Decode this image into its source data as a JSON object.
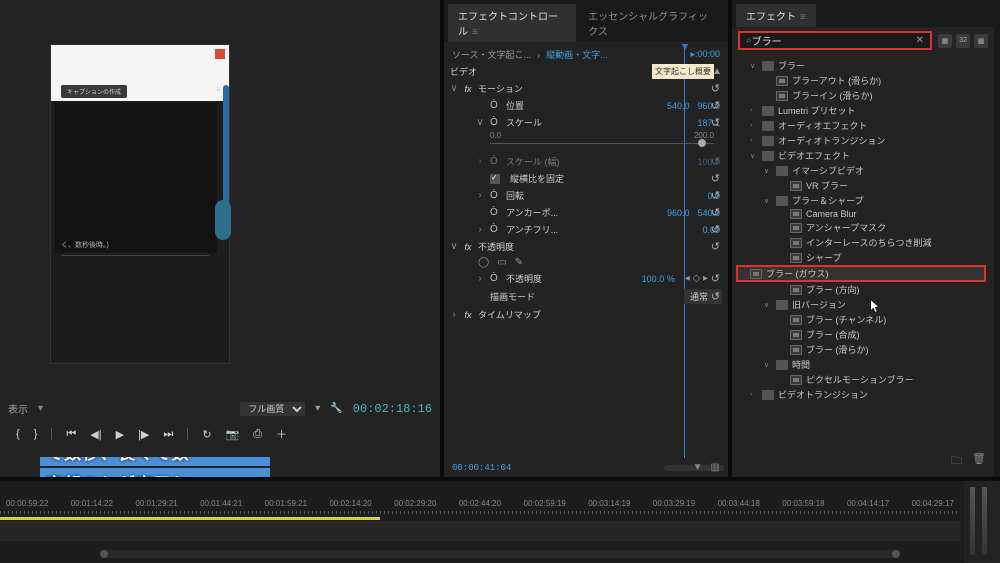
{
  "monitor": {
    "chip": "キャプションの作成",
    "preview_text": "く、数秒後時。)",
    "caption_line1": "て数秒、長くて数",
    "caption_line2": "字起こしが完了し",
    "display_label": "表示",
    "fit_label": "フル画質",
    "timecode": "00:02:18:16",
    "transport": {
      "first": "⏮",
      "step_back": "◀|",
      "back": "◀",
      "play": "▶",
      "fwd": "▶",
      "step_fwd": "|▶",
      "last": "⏭",
      "mark_in": "{",
      "mark_out": "}",
      "loop": "↻",
      "cam": "📷",
      "export": "⎙",
      "plus": "＋"
    }
  },
  "ec": {
    "tab_active": "エフェクトコントロール",
    "tab2": "エッセンシャルグラフィックス",
    "source_prefix": "ソース・文字起こ...",
    "src_link": "縦動画・文字...",
    "tl_start": ":00:00",
    "marker_label": "文字起こし概要",
    "video_label": "ビデオ",
    "motion": "モーション",
    "position": "位置",
    "pos_x": "540.0",
    "pos_y": "960.0",
    "scale": "スケール",
    "scale_val": "187.1",
    "slider_min": "0.0",
    "slider_max": "200.0",
    "scale_w": "スケール (幅)",
    "scale_w_val": "100.0",
    "uniform": "縦横比を固定",
    "rotation": "回転",
    "rotation_val": "0.0",
    "anchor": "アンカーポ...",
    "anchor_x": "960.0",
    "anchor_y": "540.0",
    "antiflicker": "アンチフリ...",
    "antiflicker_val": "0.00",
    "opacity": "不透明度",
    "opacity_val_lbl": "不透明度",
    "opacity_val": "100.0 %",
    "blend": "描画モード",
    "blend_val": "通常",
    "timeremap": "タイムリマップ",
    "foot_tc": "00:00:41:04"
  },
  "fx": {
    "tab": "エフェクト",
    "search": "ブラー",
    "icons": [
      "▦",
      "32",
      "▦"
    ],
    "tree": [
      {
        "ind": 1,
        "arr": "∨",
        "type": "fold",
        "txt": "ブラー"
      },
      {
        "ind": 2,
        "arr": "",
        "type": "pre",
        "txt": "ブラーアウト (滑らか)"
      },
      {
        "ind": 2,
        "arr": "",
        "type": "pre",
        "txt": "ブラーイン (滑らか)"
      },
      {
        "ind": 1,
        "arr": "›",
        "type": "fold",
        "txt": "Lumetri プリセット"
      },
      {
        "ind": 1,
        "arr": "›",
        "type": "fold",
        "txt": "オーディオエフェクト"
      },
      {
        "ind": 1,
        "arr": "›",
        "type": "fold",
        "txt": "オーディオトランジション"
      },
      {
        "ind": 1,
        "arr": "∨",
        "type": "fold",
        "txt": "ビデオエフェクト"
      },
      {
        "ind": 2,
        "arr": "∨",
        "type": "fold",
        "txt": "イマーシブビデオ"
      },
      {
        "ind": 3,
        "arr": "",
        "type": "pre",
        "txt": "VR ブラー"
      },
      {
        "ind": 2,
        "arr": "∨",
        "type": "fold",
        "txt": "ブラー＆シャープ"
      },
      {
        "ind": 3,
        "arr": "",
        "type": "pre",
        "txt": "Camera Blur"
      },
      {
        "ind": 3,
        "arr": "",
        "type": "pre",
        "txt": "アンシャープマスク"
      },
      {
        "ind": 3,
        "arr": "",
        "type": "pre",
        "txt": "インターレースのちらつき削減"
      },
      {
        "ind": 3,
        "arr": "",
        "type": "pre",
        "txt": "シャープ"
      },
      {
        "ind": 3,
        "arr": "",
        "type": "pre",
        "txt": "ブラー (ガウス)",
        "hl": true
      },
      {
        "ind": 3,
        "arr": "",
        "type": "pre",
        "txt": "ブラー (方向)"
      },
      {
        "ind": 2,
        "arr": "∨",
        "type": "fold",
        "txt": "旧バージョン"
      },
      {
        "ind": 3,
        "arr": "",
        "type": "pre",
        "txt": "ブラー (チャンネル)"
      },
      {
        "ind": 3,
        "arr": "",
        "type": "pre",
        "txt": "ブラー (合成)"
      },
      {
        "ind": 3,
        "arr": "",
        "type": "pre",
        "txt": "ブラー (滑らか)"
      },
      {
        "ind": 2,
        "arr": "∨",
        "type": "fold",
        "txt": "時間"
      },
      {
        "ind": 3,
        "arr": "",
        "type": "pre",
        "txt": "ピクセルモーションブラー"
      },
      {
        "ind": 1,
        "arr": "›",
        "type": "fold",
        "txt": "ビデオトランジション"
      }
    ]
  },
  "timeline": {
    "marks": [
      "00:00:59:22",
      "00:01:14:22",
      "00:01:29:21",
      "00:01:44:21",
      "00:01:59:21",
      "00:02:14:20",
      "00:02:29:20",
      "00:02:44:20",
      "00:02:59:19",
      "00:03:14:19",
      "00:03:29:19",
      "00:03:44:18",
      "00:03:59:18",
      "00:04:14:17",
      "00:04:29:17"
    ]
  }
}
